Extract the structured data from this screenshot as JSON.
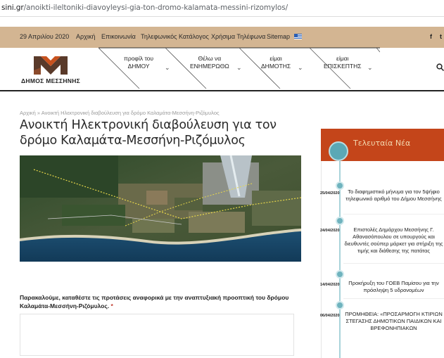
{
  "browser": {
    "url_host": "sini.gr",
    "url_path": "/anoikti-ileltoniki-diavoyleysi-gia-ton-dromo-kalamata-messini-rizomylos/"
  },
  "topbar": {
    "date": "29 Απριλίου 2020",
    "links": [
      "Αρχική",
      "Επικοινωνία",
      "Τηλεφωνικός Κατάλογος",
      "Χρήσιμα Τηλέφωνα",
      "Sitemap"
    ],
    "social": [
      "f",
      "t"
    ]
  },
  "header": {
    "logo_text": "ΔΗΜΟΣ ΜΕΣΣΗΝΗΣ",
    "menu": [
      {
        "line1": "προφίλ του",
        "line2": "ΔΗΜΟΥ"
      },
      {
        "line1": "Θέλω να",
        "line2": "ΕΝΗΜΕΡΩΘΩ"
      },
      {
        "line1": "είμαι",
        "line2": "ΔΗΜΟΤΗΣ"
      },
      {
        "line1": "είμαι",
        "line2": "ΕΠΙΣΚΕΠΤΗΣ"
      }
    ],
    "search_icon": "search-icon"
  },
  "breadcrumb": {
    "home": "Αρχική",
    "separator": "»",
    "current": "Ανοικτή Ηλεκτρονική διαβούλευση για δρόμο Καλαμάτα-Μεσσήνη-Ριζόμυλος"
  },
  "article": {
    "title": "Ανοικτή Ηλεκτρονική διαβούλευση για τον δρόμο Καλαμάτα-Μεσσήνη-Ριζόμυλος"
  },
  "form": {
    "question": "Παρακαλούμε, καταθέστε τις προτάσεις αναφορικά με την αναπτυξιακή προοπτική του δρόμου Καλαμάτα-Μεσσήνη-Ριζόμυλος.",
    "required_mark": "*",
    "answer_value": ""
  },
  "sidebar": {
    "heading": "Τελευταία Νέα",
    "news": [
      {
        "date": "25/04/2020",
        "text": "Το διαφημιστικό μήνυμα για τον 5ψήφιο τηλεφωνικό αριθμό του Δήμου Μεσσήνης"
      },
      {
        "date": "24/04/2020",
        "text": "Επιστολές Δημάρχου Μεσσήνης Γ. Αθανασόπουλου σε υπουργούς και διευθυντές σούπερ μάρκετ για στήριξη της τιμής και διάθεσης της πατάτας"
      },
      {
        "date": "14/04/2020",
        "text": "Προκήρυξη του ΓΟΕΒ Παμίσου για την πρόσληψη 5 υδρονομέων"
      },
      {
        "date": "06/04/2020",
        "text": "ΠΡΟΜΗΘΕΙΑ: «ΠΡΟΣΑΡΜΟΓΗ ΚΤΙΡΙΩΝ ΣΤΕΓΑΣΗΣ ΔΗΜΟΤΙΚΩΝ ΠΑΙΔΙΚΩΝ ΚΑΙ ΒΡΕΦΟΝΗΠΙΑΚΩΝ"
      }
    ]
  },
  "colors": {
    "topbar": "#d3b592",
    "news_header": "#c4451a",
    "timeline": "#6fb3be",
    "required": "#c0392b"
  }
}
